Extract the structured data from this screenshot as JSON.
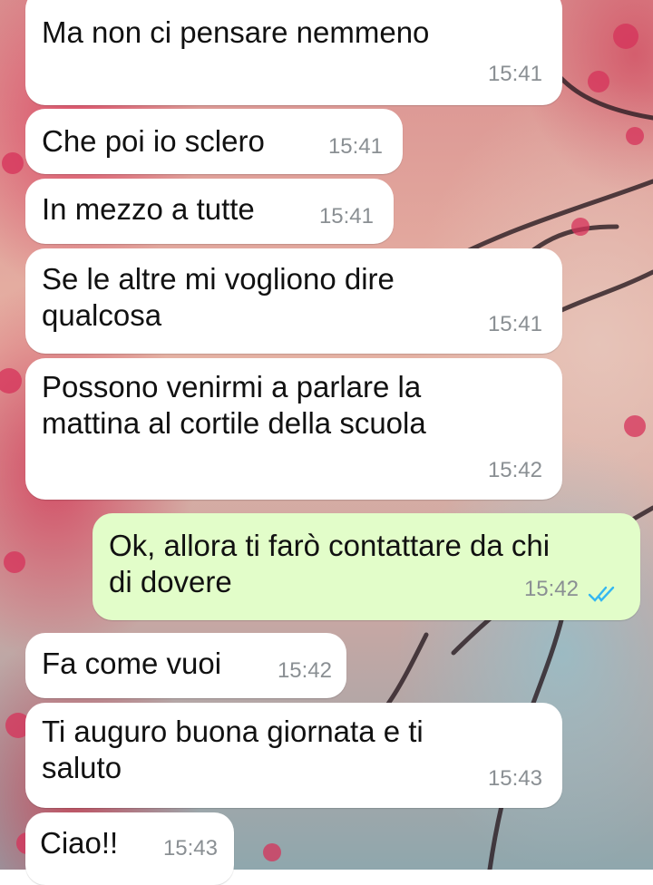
{
  "conversation": {
    "messages": [
      {
        "direction": "incoming",
        "text": "Ma non ci pensare nemmeno",
        "time": "15:41"
      },
      {
        "direction": "incoming",
        "text": "Che poi io sclero",
        "time": "15:41"
      },
      {
        "direction": "incoming",
        "text": "In mezzo a tutte",
        "time": "15:41"
      },
      {
        "direction": "incoming",
        "text": "Se le altre mi vogliono dire\nqualcosa",
        "time": "15:41"
      },
      {
        "direction": "incoming",
        "text": "Possono venirmi a parlare la\nmattina al cortile della scuola",
        "time": "15:42"
      },
      {
        "direction": "outgoing",
        "text": "Ok, allora ti farò contattare da chi\ndi dovere",
        "time": "15:42",
        "status": "read",
        "status_icon": "double-check-icon",
        "status_color": "#34b7f1"
      },
      {
        "direction": "incoming",
        "text": "Fa come vuoi",
        "time": "15:42"
      },
      {
        "direction": "incoming",
        "text": "Ti auguro buona giornata e ti\nsaluto",
        "time": "15:43"
      },
      {
        "direction": "incoming",
        "text": "Ciao!!",
        "time": "15:43"
      }
    ]
  },
  "colors": {
    "incoming_bubble": "#ffffff",
    "outgoing_bubble": "#e2fdc9",
    "timestamp": "#8a8f93",
    "read_ticks": "#34b7f1"
  }
}
